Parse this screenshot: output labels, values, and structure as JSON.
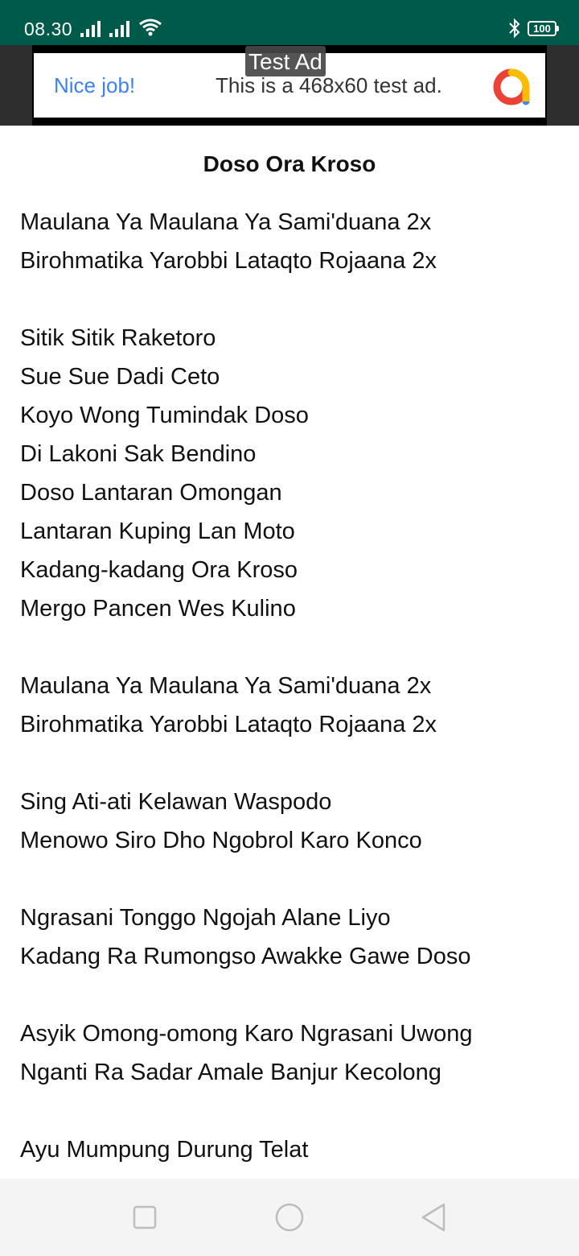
{
  "status_bar": {
    "time": "08.30",
    "battery": "100",
    "icons": [
      "signal-icon",
      "signal-icon",
      "wifi-icon",
      "bluetooth-icon",
      "battery-icon"
    ]
  },
  "ad": {
    "tag": "Test Ad",
    "headline": "Nice job!",
    "body": "This is a 468x60 test ad.",
    "headline_color": "#3b82f0"
  },
  "song": {
    "title": "Doso Ora Kroso",
    "lines": [
      "Maulana Ya Maulana Ya Sami'duana 2x",
      "Birohmatika Yarobbi Lataqto Rojaana 2x",
      "",
      "Sitik Sitik Raketoro",
      "Sue Sue Dadi Ceto",
      "Koyo Wong Tumindak Doso",
      "Di Lakoni Sak Bendino",
      "Doso Lantaran Omongan",
      "Lantaran Kuping Lan Moto",
      "Kadang-kadang Ora Kroso",
      "Mergo Pancen Wes Kulino",
      "",
      "Maulana Ya Maulana Ya Sami'duana 2x",
      "Birohmatika Yarobbi Lataqto Rojaana 2x",
      "",
      "Sing Ati-ati Kelawan Waspodo",
      "Menowo Siro Dho Ngobrol Karo Konco",
      "",
      "Ngrasani Tonggo Ngojah Alane Liyo",
      "Kadang Ra Rumongso Awakke Gawe Doso",
      "",
      "Asyik Omong-omong Karo Ngrasani Uwong",
      "Nganti Ra Sadar Amale Banjur Kecolong",
      "",
      "Ayu Mumpung Durung Telat"
    ]
  },
  "nav": {
    "buttons": [
      "recents-button",
      "home-button",
      "back-button"
    ]
  },
  "colors": {
    "status_bar": "#005a4a",
    "ad_background": "#2e2e2e",
    "nav_background": "#f4f4f4"
  }
}
